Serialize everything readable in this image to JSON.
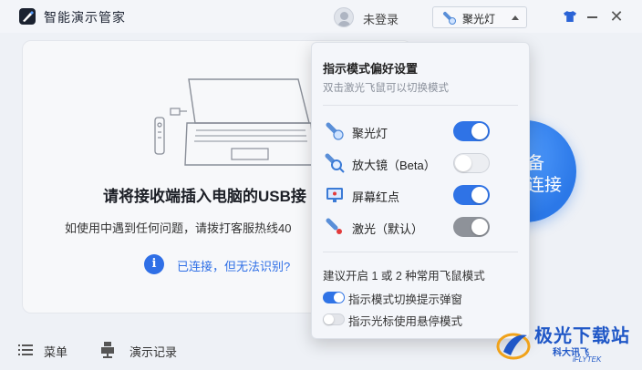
{
  "app": {
    "title": "智能演示管家",
    "login_text": "未登录",
    "mode_selected": "聚光灯",
    "accent_color": "#2f73e6"
  },
  "icons": {
    "logo": "app-logo-icon",
    "avatar": "user-avatar-icon",
    "skin": "shirt-icon",
    "minimize": "minimize-icon",
    "close": "close-icon",
    "info": "info-icon",
    "menu": "hamburger-menu-icon",
    "record": "presentation-record-icon"
  },
  "main": {
    "headline": "请将接收端插入电脑的USB接",
    "help_text": "如使用中遇到任何问题，请拨打客服热线40",
    "info_glyph": "i",
    "connected_link": "已连接，但无法识别?",
    "connect_button_text": "备\n连接"
  },
  "bottom": {
    "menu_label": "菜单",
    "record_label": "演示记录"
  },
  "popup": {
    "title": "指示模式偏好设置",
    "subtitle": "双击激光飞鼠可以切换模式",
    "modes": [
      {
        "label": "聚光灯",
        "icon": "spotlight-icon",
        "state": "on"
      },
      {
        "label": "放大镜（Beta）",
        "icon": "magnifier-icon",
        "state": "off"
      },
      {
        "label": "屏幕红点",
        "icon": "screen-red-dot-icon",
        "state": "on"
      },
      {
        "label": "激光（默认）",
        "icon": "laser-icon",
        "state": "locked-on"
      }
    ],
    "suggest_text": "建议开启 1 或 2 种常用飞鼠模式",
    "options": [
      {
        "label": "指示模式切换提示弹窗",
        "state": "on"
      },
      {
        "label": "指示光标使用悬停模式",
        "state": "off"
      }
    ]
  },
  "watermark": {
    "main": "极光下载站",
    "sub": "科大讯飞",
    "sub2": "iFLYTEK"
  }
}
